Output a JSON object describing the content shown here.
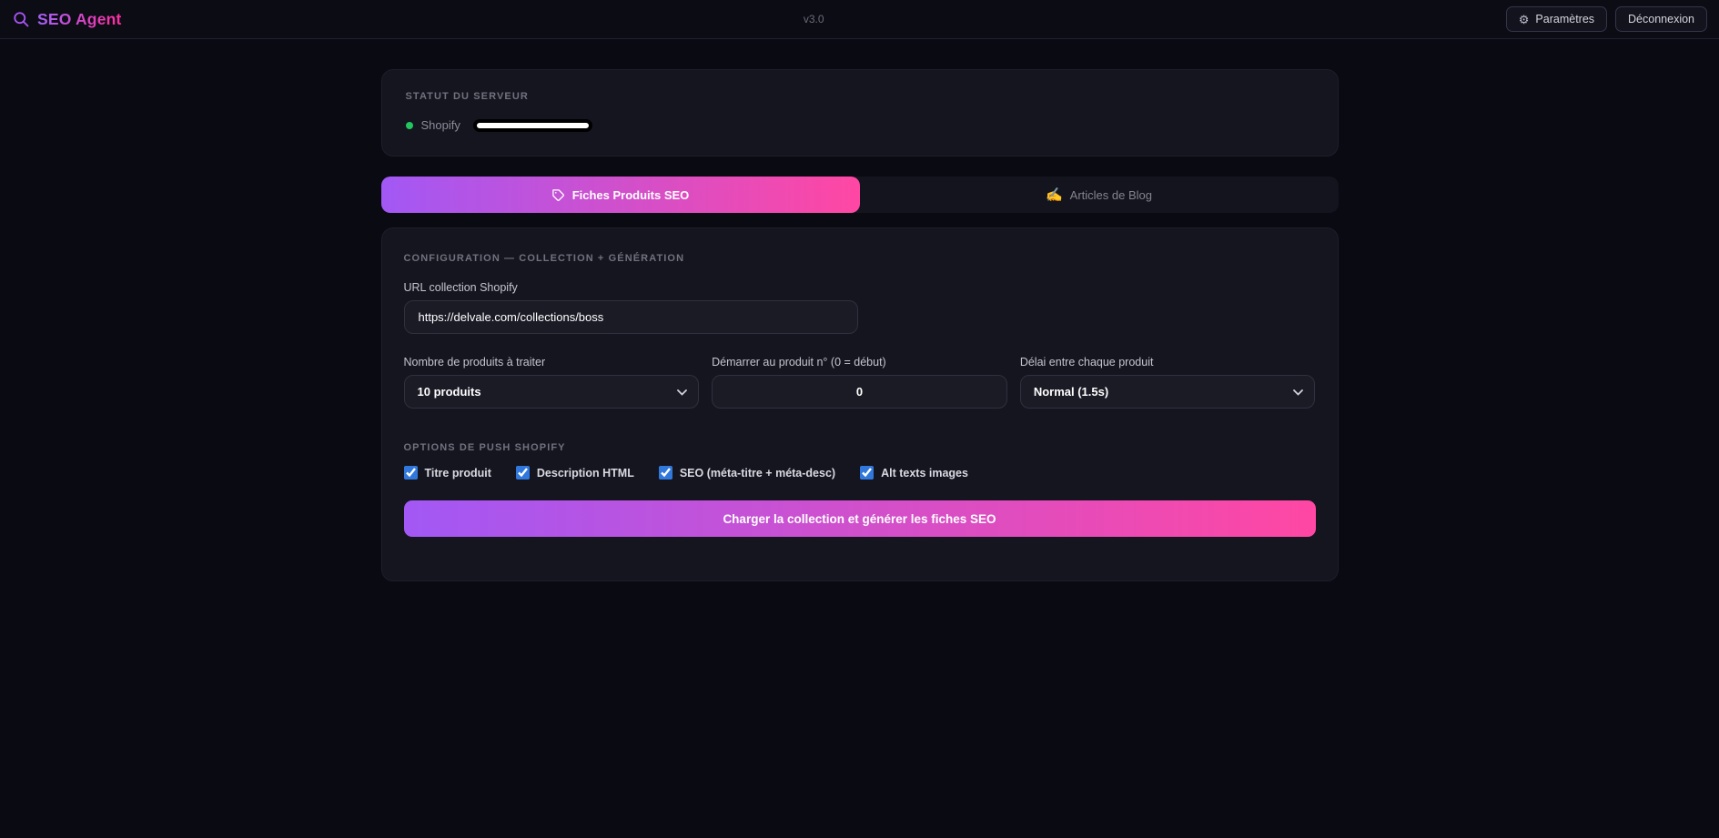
{
  "topbar": {
    "logo_text": "SEO Agent",
    "version": "v3.0",
    "settings_label": "Paramètres",
    "logout_label": "Déconnexion"
  },
  "status_card": {
    "heading": "STATUT DU SERVEUR",
    "service_name": "Shopify",
    "status_color": "#22c55e",
    "value_redacted": true
  },
  "tabs": {
    "products": {
      "label": "Fiches Produits SEO",
      "icon": "tag-icon",
      "active": true
    },
    "blog": {
      "label": "Articles de Blog",
      "icon": "writing-hand-icon",
      "active": false
    }
  },
  "config": {
    "heading": "CONFIGURATION — COLLECTION + GÉNÉRATION",
    "url": {
      "label": "URL collection Shopify",
      "value": "https://delvale.com/collections/boss"
    },
    "fields": [
      {
        "label": "Nombre de produits à traiter",
        "value": "10 produits",
        "type": "select"
      },
      {
        "label": "Démarrer au produit n° (0 = début)",
        "value": "0",
        "type": "number"
      },
      {
        "label": "Délai entre chaque produit",
        "value": "Normal (1.5s)",
        "type": "select"
      }
    ],
    "options_heading": "OPTIONS DE PUSH SHOPIFY",
    "options": [
      {
        "label": "Titre produit",
        "checked": true
      },
      {
        "label": "Description HTML",
        "checked": true
      },
      {
        "label": "SEO (méta-titre + méta-desc)",
        "checked": true
      },
      {
        "label": "Alt texts images",
        "checked": true
      }
    ],
    "submit_label": "Charger la collection et générer les fiches SEO"
  },
  "colors": {
    "accent_gradient_start": "#a258f5",
    "accent_gradient_end": "#ff47a3",
    "status_green": "#22c55e",
    "checkbox_blue": "#3178dd",
    "page_background": "#0a0a12",
    "card_background": "#15151f"
  }
}
